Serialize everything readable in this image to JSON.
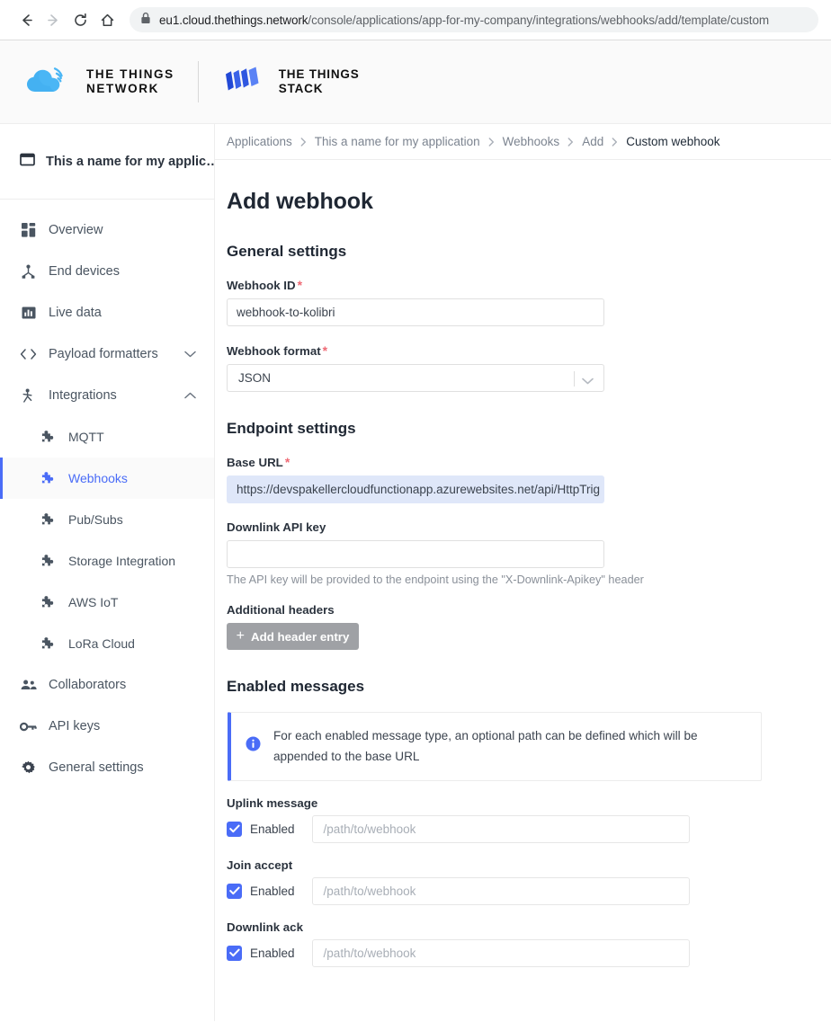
{
  "browser": {
    "back_icon": "back-arrow-icon",
    "forward_icon": "forward-arrow-icon",
    "reload_icon": "reload-icon",
    "home_icon": "home-icon",
    "lock_icon": "lock-icon",
    "url_host": "eu1.cloud.thethings.network",
    "url_path": "/console/applications/app-for-my-company/integrations/webhooks/add/template/custom"
  },
  "header": {
    "ttn_logo_line1": "THE THINGS",
    "ttn_logo_line2": "NETWORK",
    "stack_logo_line1": "THE THINGS",
    "stack_logo_line2": "STACK"
  },
  "sidebar": {
    "app_title": "This a name for my applic…",
    "app_icon": "application-icon",
    "items": [
      {
        "label": "Overview",
        "icon": "overview-grid-icon",
        "active": false,
        "sub": false,
        "chevron": ""
      },
      {
        "label": "End devices",
        "icon": "end-devices-icon",
        "active": false,
        "sub": false,
        "chevron": ""
      },
      {
        "label": "Live data",
        "icon": "live-data-icon",
        "active": false,
        "sub": false,
        "chevron": ""
      },
      {
        "label": "Payload formatters",
        "icon": "code-brackets-icon",
        "active": false,
        "sub": false,
        "chevron": "down"
      },
      {
        "label": "Integrations",
        "icon": "integrations-icon",
        "active": false,
        "sub": false,
        "chevron": "up"
      },
      {
        "label": "MQTT",
        "icon": "puzzle-icon",
        "active": false,
        "sub": true,
        "chevron": ""
      },
      {
        "label": "Webhooks",
        "icon": "puzzle-icon",
        "active": true,
        "sub": true,
        "chevron": ""
      },
      {
        "label": "Pub/Subs",
        "icon": "puzzle-icon",
        "active": false,
        "sub": true,
        "chevron": ""
      },
      {
        "label": "Storage Integration",
        "icon": "puzzle-icon",
        "active": false,
        "sub": true,
        "chevron": ""
      },
      {
        "label": "AWS IoT",
        "icon": "puzzle-icon",
        "active": false,
        "sub": true,
        "chevron": ""
      },
      {
        "label": "LoRa Cloud",
        "icon": "puzzle-icon",
        "active": false,
        "sub": true,
        "chevron": ""
      },
      {
        "label": "Collaborators",
        "icon": "collaborators-icon",
        "active": false,
        "sub": false,
        "chevron": ""
      },
      {
        "label": "API keys",
        "icon": "key-icon",
        "active": false,
        "sub": false,
        "chevron": ""
      },
      {
        "label": "General settings",
        "icon": "gear-icon",
        "active": false,
        "sub": false,
        "chevron": ""
      }
    ]
  },
  "breadcrumb": [
    {
      "label": "Applications",
      "current": false
    },
    {
      "label": "This a name for my application",
      "current": false
    },
    {
      "label": "Webhooks",
      "current": false
    },
    {
      "label": "Add",
      "current": false
    },
    {
      "label": "Custom webhook",
      "current": true
    }
  ],
  "main": {
    "page_title": "Add webhook",
    "general_settings": {
      "title": "General settings",
      "webhook_id_label": "Webhook ID",
      "webhook_id_value": "webhook-to-kolibri",
      "webhook_format_label": "Webhook format",
      "webhook_format_value": "JSON",
      "required_mark": "*"
    },
    "endpoint_settings": {
      "title": "Endpoint settings",
      "base_url_label": "Base URL",
      "base_url_value": "https://devspakellercloudfunctionapp.azurewebsites.net/api/HttpTrig",
      "downlink_api_key_label": "Downlink API key",
      "downlink_api_key_value": "",
      "downlink_help": "The API key will be provided to the endpoint using the \"X-Downlink-Apikey\" header",
      "additional_headers_label": "Additional headers",
      "add_header_button": "Add header entry",
      "add_header_icon": "plus-icon"
    },
    "enabled_messages": {
      "title": "Enabled messages",
      "info_icon": "info-circle-icon",
      "info_text": "For each enabled message type, an optional path can be defined which will be appended to the base URL",
      "rows": [
        {
          "label": "Uplink message",
          "enabled": true,
          "checkbox_label": "Enabled",
          "path_placeholder": "/path/to/webhook",
          "path_value": ""
        },
        {
          "label": "Join accept",
          "enabled": true,
          "checkbox_label": "Enabled",
          "path_placeholder": "/path/to/webhook",
          "path_value": ""
        },
        {
          "label": "Downlink ack",
          "enabled": true,
          "checkbox_label": "Enabled",
          "path_placeholder": "/path/to/webhook",
          "path_value": ""
        }
      ]
    }
  },
  "colors": {
    "accent_blue": "#4a6cf7",
    "required_red": "#ef6a75",
    "button_grey": "#9fa1a5",
    "selection_blue": "#dfe7f9"
  }
}
